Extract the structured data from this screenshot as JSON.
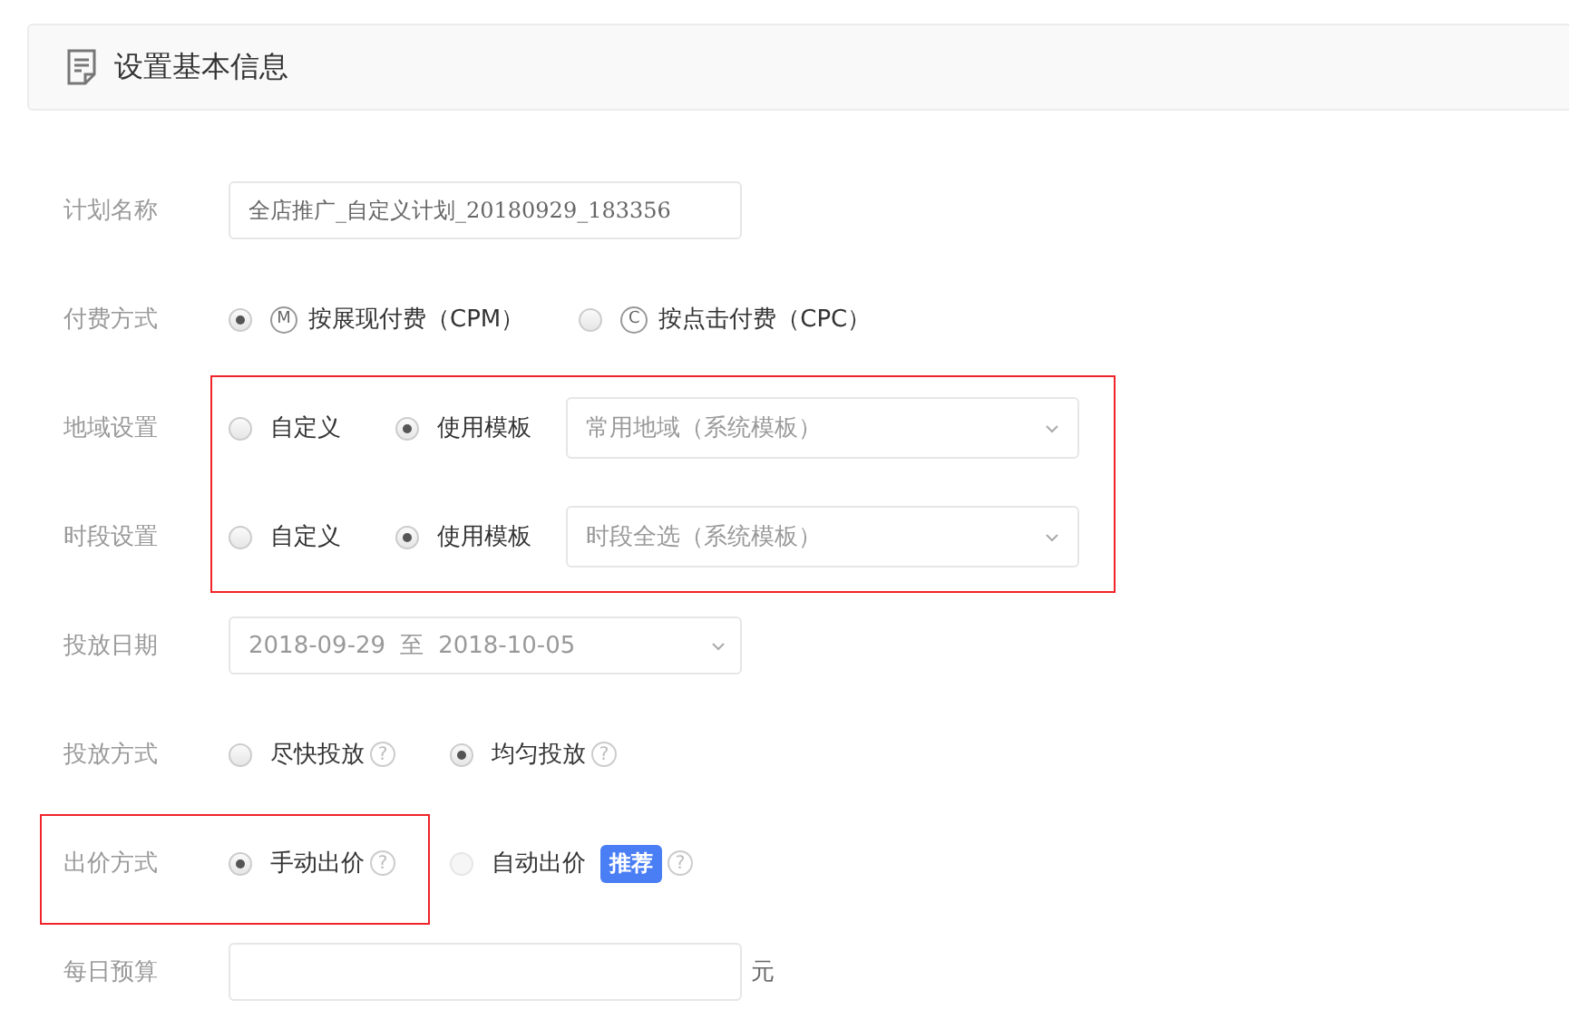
{
  "header": {
    "title": "设置基本信息"
  },
  "groups": [
    {
      "highlighted": false,
      "rows": [
        {
          "kind": "input",
          "label": "计划名称",
          "value": "全店推广_自定义计划_20180929_183356"
        },
        {
          "kind": "radio",
          "label": "付费方式",
          "options": [
            {
              "label": "按展现付费（CPM）",
              "badge": "M",
              "selected": true,
              "disabled": false
            },
            {
              "label": "按点击付费（CPC）",
              "badge": "C",
              "selected": false,
              "disabled": false
            }
          ]
        }
      ]
    },
    {
      "highlighted": true,
      "rows": [
        {
          "kind": "template",
          "label": "地域设置",
          "options": [
            {
              "label": "自定义",
              "selected": false,
              "disabled": false
            },
            {
              "label": "使用模板",
              "selected": true,
              "disabled": false
            }
          ],
          "select": "常用地域（系统模板）"
        },
        {
          "kind": "template",
          "label": "时段设置",
          "options": [
            {
              "label": "自定义",
              "selected": false,
              "disabled": false
            },
            {
              "label": "使用模板",
              "selected": true,
              "disabled": false
            }
          ],
          "select": "时段全选（系统模板）"
        }
      ]
    },
    {
      "highlighted": false,
      "rows": [
        {
          "kind": "date",
          "label": "投放日期",
          "start": "2018-09-29",
          "separator": "至",
          "end": "2018-10-05"
        },
        {
          "kind": "radio",
          "label": "投放方式",
          "options": [
            {
              "label": "尽快投放",
              "help": "?",
              "selected": false,
              "disabled": false
            },
            {
              "label": "均匀投放",
              "help": "?",
              "selected": true,
              "disabled": false
            }
          ]
        },
        {
          "kind": "radio",
          "label": "出价方式",
          "highlighted": true,
          "options": [
            {
              "label": "手动出价",
              "help": "?",
              "selected": true,
              "disabled": false
            },
            {
              "label": "自动出价",
              "tag": "推荐",
              "help": "?",
              "selected": false,
              "disabled": true
            }
          ]
        },
        {
          "kind": "budget",
          "label": "每日预算",
          "unit": "元"
        }
      ]
    }
  ]
}
